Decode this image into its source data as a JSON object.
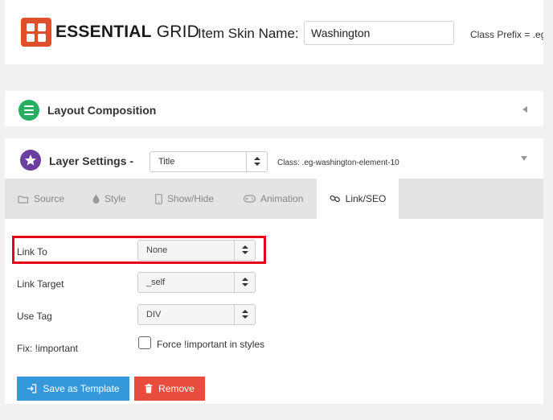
{
  "header": {
    "logo_bold": "ESSENTIAL",
    "logo_light": " GRID",
    "skin_name_label": "Item Skin Name:",
    "skin_name_value": "Washington",
    "class_prefix": "Class Prefix = .eg-w"
  },
  "layout_panel": {
    "title": "Layout Composition",
    "icon": "list-icon"
  },
  "layer_panel": {
    "title": "Layer Settings -",
    "icon": "star-icon",
    "selected_layer": "Title",
    "class_text": "Class: .eg-washington-element-10"
  },
  "tabs": [
    {
      "label": "Source",
      "icon": "folder-icon"
    },
    {
      "label": "Style",
      "icon": "drop-icon"
    },
    {
      "label": "Show/Hide",
      "icon": "mobile-icon"
    },
    {
      "label": "Animation",
      "icon": "gamepad-icon"
    },
    {
      "label": "Link/SEO",
      "icon": "link-icon",
      "active": true
    }
  ],
  "form": {
    "link_to_label": "Link To",
    "link_to_value": "None",
    "link_target_label": "Link Target",
    "link_target_value": "_self",
    "use_tag_label": "Use Tag",
    "use_tag_value": "DIV",
    "fix_important_label": "Fix: !important",
    "force_important_label": "Force !important in styles",
    "force_important_checked": false
  },
  "buttons": {
    "save_template": "Save as Template",
    "remove": "Remove"
  },
  "colors": {
    "logo": "#e04f2c",
    "layout_icon": "#27ae60",
    "layer_icon": "#6b3fa0",
    "save_button": "#3498db",
    "remove_button": "#e74c3c",
    "highlight": "#e5001c"
  }
}
